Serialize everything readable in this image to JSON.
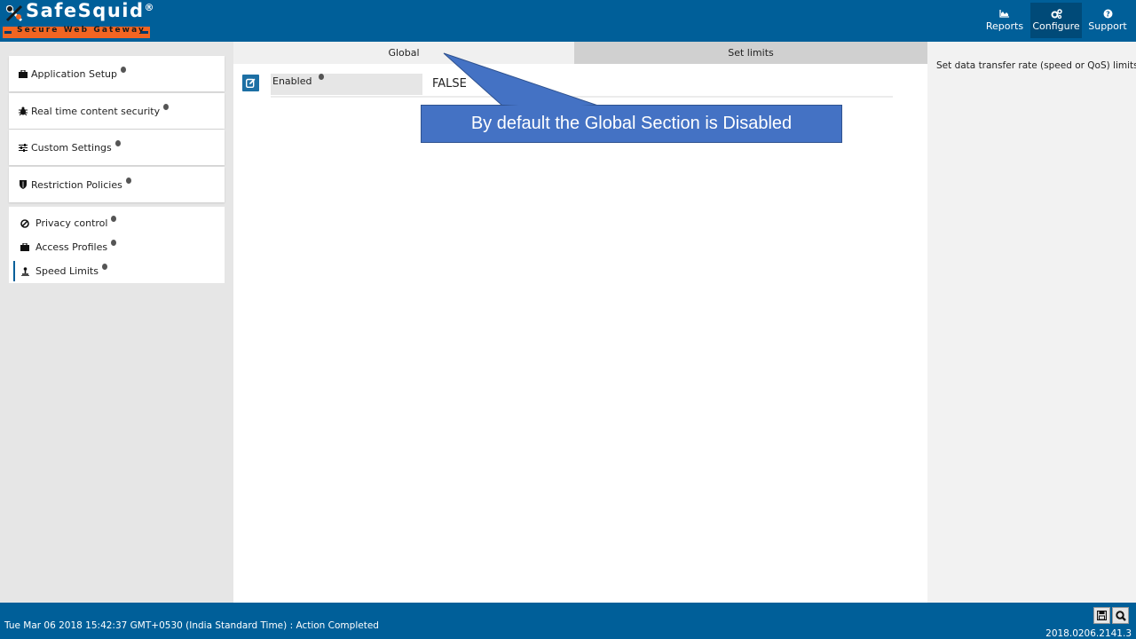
{
  "app": {
    "brand": "SafeSquid",
    "brand_mark": "®",
    "tagline": "Secure Web Gateway"
  },
  "nav": {
    "items": [
      {
        "label": "Reports",
        "icon": "chart-area-icon",
        "active": false
      },
      {
        "label": "Configure",
        "icon": "cogs-icon",
        "active": true
      },
      {
        "label": "Support",
        "icon": "question-circle-icon",
        "active": false
      }
    ]
  },
  "sidebar": {
    "sections": [
      {
        "label": "Application Setup",
        "icon": "briefcase-icon"
      },
      {
        "label": "Real time content security",
        "icon": "bug-icon"
      },
      {
        "label": "Custom Settings",
        "icon": "sliders-icon"
      },
      {
        "label": "Restriction Policies",
        "icon": "shield-icon"
      }
    ],
    "sub_items": [
      {
        "label": "Privacy control",
        "icon": "ban-icon",
        "active": false
      },
      {
        "label": "Access Profiles",
        "icon": "briefcase-icon",
        "active": false
      },
      {
        "label": "Speed Limits",
        "icon": "speed-icon",
        "active": true
      }
    ]
  },
  "main": {
    "tabs": [
      {
        "label": "Global",
        "active": true
      },
      {
        "label": "Set limits",
        "active": false
      }
    ],
    "fields": [
      {
        "label": "Enabled",
        "value": "FALSE"
      }
    ]
  },
  "callout": {
    "text": "By default the Global Section is Disabled",
    "color": "#4472c4"
  },
  "help": {
    "text": "Set data transfer rate (speed or QoS) limits."
  },
  "footer": {
    "status": "Tue Mar 06 2018 15:42:37 GMT+0530 (India Standard Time) : Action Completed",
    "version": "2018.0206.2141.3"
  },
  "colors": {
    "primary": "#005f99",
    "accent": "#f26522",
    "nav_active": "#004a78"
  }
}
